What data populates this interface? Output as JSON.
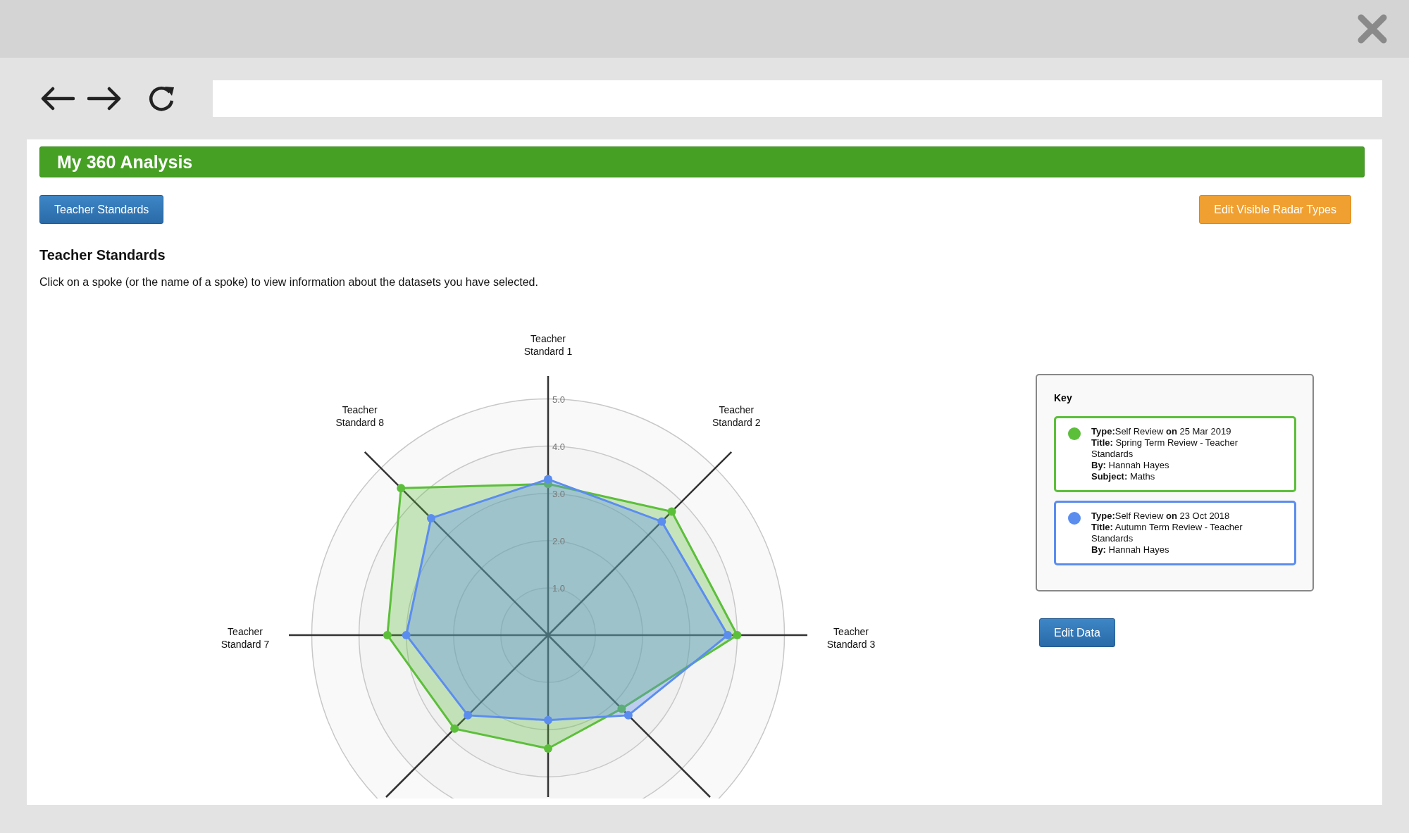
{
  "header": {
    "title": "My 360 Analysis"
  },
  "buttons": {
    "left": "Teacher Standards",
    "right": "Edit Visible Radar Types"
  },
  "section": {
    "heading": "Teacher Standards",
    "instructions": "Click on a spoke (or the name of a spoke) to view information about the datasets you have selected."
  },
  "radar": {
    "spoke_labels": {
      "top": "Teacher Standard 1",
      "upper": [
        "Teacher Standard 8",
        "Teacher Standard 2"
      ],
      "middle": [
        "Teacher Standard 7",
        "Teacher Standard 3"
      ]
    },
    "ring_labels": [
      "5.0",
      "4.0",
      "3.0",
      "2.0",
      "1.0"
    ],
    "series": [
      {
        "color": "#5cbf3a"
      },
      {
        "color": "#5b8def"
      }
    ]
  },
  "key": {
    "title": "Key",
    "items": [
      {
        "color": "#5cbf3a",
        "lines": [
          "**Type:**Self Review **on** 25 Mar 2019",
          "**Title:** Spring Term Review - Teacher Standards",
          "**By:** Hannah Hayes",
          "**Subject:** Maths"
        ]
      },
      {
        "color": "#5b8def",
        "lines": [
          "**Type:**Self Review **on** 23 Oct 2018",
          "**Title:** Autumn Term Review - Teacher Standards",
          "**By:** Hannah Hayes"
        ]
      }
    ]
  },
  "edit_button": "Edit Data"
}
